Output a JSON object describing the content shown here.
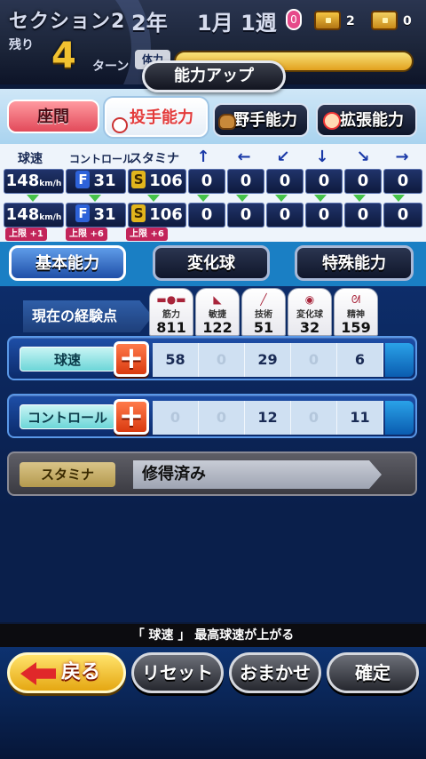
{
  "status": {
    "section": "セクション2",
    "year": "2年",
    "month": "1月",
    "week": "1週",
    "mic_badge": "0",
    "chest_gold_count": "2",
    "chest_silver_count": "0",
    "remain_label": "残り",
    "remain_turns": "4",
    "turn_label": "ターン",
    "stamina_label": "体力"
  },
  "title": "能力アップ",
  "tabs": {
    "zama": "座間",
    "pitcher": "投手能力",
    "fielder": "野手能力",
    "extended": "拡張能力"
  },
  "stats": {
    "headers": [
      "球速",
      "コントロール",
      "スタミナ"
    ],
    "arrows": [
      "↑",
      "←",
      "↙",
      "↓",
      "↘",
      "→"
    ],
    "current": {
      "speed": "148",
      "speed_unit": "km/h",
      "control_rank": "F",
      "control": "31",
      "stamina_rank": "S",
      "stamina": "106",
      "arrows": [
        "0",
        "0",
        "0",
        "0",
        "0",
        "0"
      ]
    },
    "after": {
      "speed": "148",
      "speed_unit": "km/h",
      "control_rank": "F",
      "control": "31",
      "stamina_rank": "S",
      "stamina": "106",
      "arrows": [
        "0",
        "0",
        "0",
        "0",
        "0",
        "0"
      ]
    },
    "limits": [
      "上限 +1",
      "上限 +6",
      "上限 +6"
    ]
  },
  "categories": {
    "basic": "基本能力",
    "henka": "変化球",
    "special": "特殊能力"
  },
  "experience": {
    "label": "現在の経験点",
    "items": [
      {
        "name": "筋力",
        "icon": "dumbbell-icon",
        "value": "811"
      },
      {
        "name": "敏捷",
        "icon": "shoe-icon",
        "value": "122"
      },
      {
        "name": "技術",
        "icon": "bat-icon",
        "value": "51"
      },
      {
        "name": "変化球",
        "icon": "ball-icon",
        "value": "32"
      },
      {
        "name": "精神",
        "icon": "spirit-icon",
        "value": "159"
      }
    ]
  },
  "skills": [
    {
      "label": "球速",
      "values": [
        "58",
        "0",
        "29",
        "0",
        "6"
      ]
    },
    {
      "label": "コントロール",
      "values": [
        "0",
        "0",
        "12",
        "0",
        "11"
      ]
    }
  ],
  "learned": {
    "label": "スタミナ",
    "text": "修得済み"
  },
  "description": "「 球速 」 最高球速が上がる",
  "buttons": {
    "back": "戻る",
    "reset": "リセット",
    "auto": "おまかせ",
    "confirm": "確定"
  }
}
